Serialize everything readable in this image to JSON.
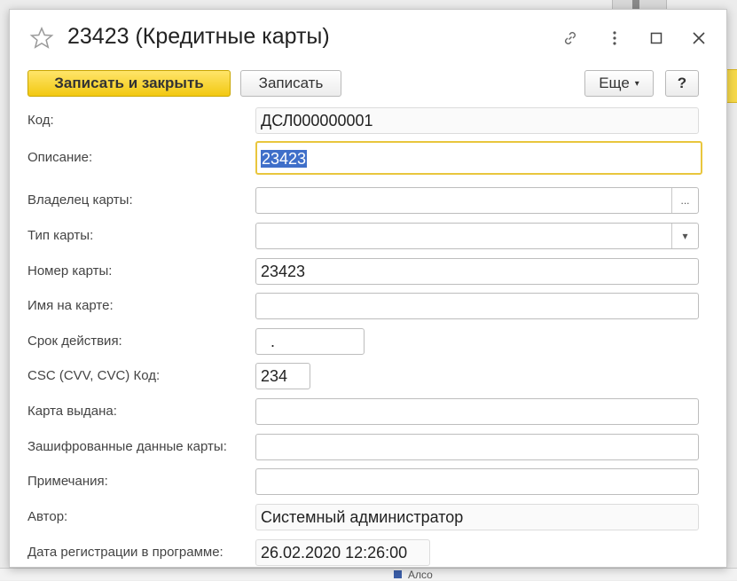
{
  "window": {
    "title": "23423 (Кредитные карты)"
  },
  "toolbar": {
    "save_close_label": "Записать и закрыть",
    "save_label": "Записать",
    "more_label": "Еще",
    "help_label": "?"
  },
  "fields": {
    "code": {
      "label": "Код:",
      "value": "ДСЛ000000001"
    },
    "description": {
      "label": "Описание:",
      "value": "23423"
    },
    "owner": {
      "label": "Владелец карты:",
      "value": "",
      "button": "..."
    },
    "card_type": {
      "label": "Тип карты:",
      "value": ""
    },
    "card_number": {
      "label": "Номер карты:",
      "value": "23423"
    },
    "name_on_card": {
      "label": "Имя на карте:",
      "value": ""
    },
    "expiry": {
      "label": "Срок действия:",
      "value": "."
    },
    "csc": {
      "label": "CSC (CVV, CVC) Код:",
      "value": "234"
    },
    "issued_by": {
      "label": "Карта выдана:",
      "value": ""
    },
    "encrypted": {
      "label": "Зашифрованные данные карты:",
      "value": ""
    },
    "notes": {
      "label": "Примечания:",
      "value": ""
    },
    "author": {
      "label": "Автор:",
      "value": "Системный администратор"
    },
    "reg_date": {
      "label": "Дата регистрации в программе:",
      "value": "26.02.2020 12:26:00"
    }
  },
  "background": {
    "fragment_text": "Алсо"
  },
  "colors": {
    "primary_button": "#f2c811",
    "focus_border": "#e9c63d",
    "selection": "#3f6fc9"
  },
  "icons": [
    "star-icon",
    "link-icon",
    "more-vert-icon",
    "maximize-icon",
    "close-icon",
    "dropdown-caret-icon"
  ]
}
